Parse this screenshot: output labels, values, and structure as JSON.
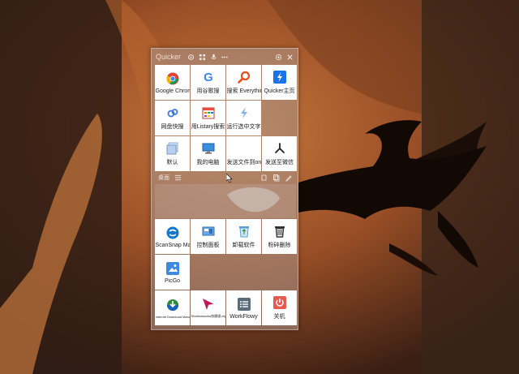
{
  "window": {
    "title": "Quicker",
    "controls": [
      "settings-icon",
      "grid-icon",
      "mic-icon",
      "more-icon",
      "pin-icon",
      "close-icon"
    ]
  },
  "top_grid": [
    {
      "label": "Google Chrome",
      "icon": "chrome-icon"
    },
    {
      "label": "用谷歌搜",
      "icon": "google-icon"
    },
    {
      "label": "搜索 Everything",
      "icon": "everything-search-icon"
    },
    {
      "label": "Quicker主页",
      "icon": "quicker-icon"
    },
    {
      "label": "网盘快搜",
      "icon": "cloud-search-icon"
    },
    {
      "label": "用Listary搜索",
      "icon": "listary-icon"
    },
    {
      "label": "运行选中文字",
      "icon": "run-lightning-icon"
    },
    {
      "label": "",
      "icon": ""
    },
    {
      "label": "默认",
      "icon": "default-folder-icon"
    },
    {
      "label": "我的电脑",
      "icon": "computer-icon"
    },
    {
      "label": "发送文件到onedrive",
      "icon": "onedrive-icon"
    },
    {
      "label": "发送至微信",
      "icon": "wechat-send-icon"
    }
  ],
  "section": {
    "title": "桌面"
  },
  "bottom_grid": [
    {
      "label": "ScanSnap Manager",
      "icon": "scansnap-icon"
    },
    {
      "label": "控制面板",
      "icon": "control-panel-icon"
    },
    {
      "label": "卸载软件",
      "icon": "recycle-icon"
    },
    {
      "label": "粉碎删除",
      "icon": "trash-icon"
    },
    {
      "label": "PicGo",
      "icon": "picgo-icon"
    },
    {
      "label": "",
      "icon": ""
    },
    {
      "label": "",
      "icon": ""
    },
    {
      "label": "",
      "icon": ""
    },
    {
      "label": "Internet Download Manager",
      "icon": "idm-icon"
    },
    {
      "label": "Shadowsocks快捷键 clipboard",
      "icon": "shadowsocks-icon"
    },
    {
      "label": "WorkFlowy",
      "icon": "workflowy-icon"
    },
    {
      "label": "关机",
      "icon": "power-icon"
    }
  ],
  "colors": {
    "accent_blue": "#1a73e8",
    "panel_bg": "rgba(170,150,140,0.55)"
  }
}
